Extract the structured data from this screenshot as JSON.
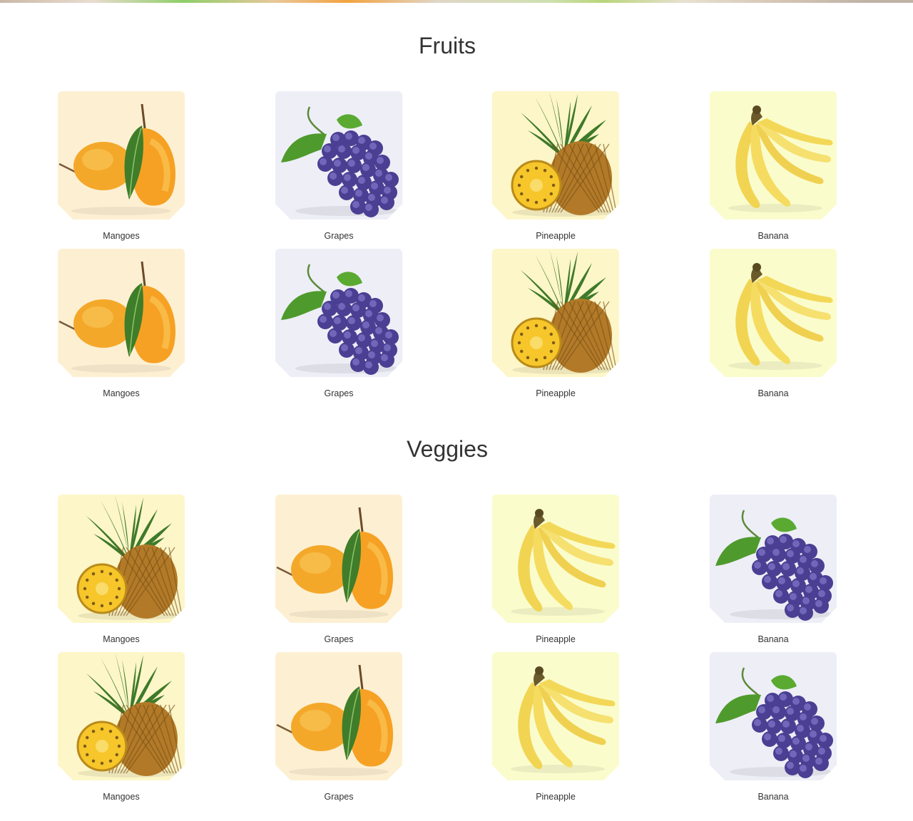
{
  "sections": [
    {
      "title": "Fruits",
      "cards": [
        {
          "label": "Mangoes",
          "icon": "mango-icon",
          "bg": "#fdf0d2"
        },
        {
          "label": "Grapes",
          "icon": "grapes-icon",
          "bg": "#eeeef7"
        },
        {
          "label": "Pineapple",
          "icon": "pineapple-icon",
          "bg": "#fdf6c8"
        },
        {
          "label": "Banana",
          "icon": "banana-icon",
          "bg": "#fafccc"
        },
        {
          "label": "Mangoes",
          "icon": "mango-icon",
          "bg": "#fdf0d2"
        },
        {
          "label": "Grapes",
          "icon": "grapes-icon",
          "bg": "#eeeef7"
        },
        {
          "label": "Pineapple",
          "icon": "pineapple-icon",
          "bg": "#fdf6c8"
        },
        {
          "label": "Banana",
          "icon": "banana-icon",
          "bg": "#fafccc"
        }
      ]
    },
    {
      "title": "Veggies",
      "cards": [
        {
          "label": "Mangoes",
          "icon": "pineapple-icon",
          "bg": "#fdf6c8"
        },
        {
          "label": "Grapes",
          "icon": "mango-icon",
          "bg": "#fdf0d2"
        },
        {
          "label": "Pineapple",
          "icon": "banana-icon",
          "bg": "#fafccc"
        },
        {
          "label": "Banana",
          "icon": "grapes-icon",
          "bg": "#eeeef7"
        },
        {
          "label": "Mangoes",
          "icon": "pineapple-icon",
          "bg": "#fdf6c8"
        },
        {
          "label": "Grapes",
          "icon": "mango-icon",
          "bg": "#fdf0d2"
        },
        {
          "label": "Pineapple",
          "icon": "banana-icon",
          "bg": "#fafccc"
        },
        {
          "label": "Banana",
          "icon": "grapes-icon",
          "bg": "#eeeef7"
        }
      ]
    }
  ]
}
